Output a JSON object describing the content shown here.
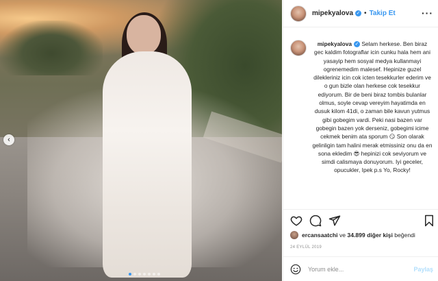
{
  "post": {
    "username": "mipekyalova",
    "separator": "•",
    "follow_label": "Takip Et",
    "more_label": "···",
    "prev_arrow": "‹",
    "carousel": {
      "count": 7,
      "active_index": 0
    }
  },
  "caption": {
    "username": "mipekyalova",
    "text_part1": " Selam herkese. Ben biraz gec kaldim fotograflar icin cunku hala hem ani yasayip hem sosyal medya kullanmayi ogrenemedim malesef. Hepinize guzel dilekleriniz icin cok icten tesekkurler ederim ve o gun bizle olan herkese cok tesekkur ediyorum. Bir de beni biraz tombis bulanlar olmus, soyle cevap vereyim hayatimda en dusuk kilom 41di, o zaman bile kavun yutmus gibi gobegim vardi. Peki nasi bazen var gobegin bazen yok derseniz, gobegimi icime cekmek benim ata sporum ",
    "emoji1": "😏",
    "text_part2": " Son olarak gelinligin tam halini merak etmissiniz onu da en sona ekledim ",
    "emoji2": "😎",
    "text_part3": " hepinizi cok seviyorum ve simdi calismaya donuyorum. Iyi geceler, opucukler, Ipek p.s Yo, Rocky!"
  },
  "likes": {
    "liker": "ercansaatchi",
    "connector": " ve ",
    "others": "34.899 diğer kişi",
    "suffix": " beğendi"
  },
  "date": "24 EYLÜL 2019",
  "comment": {
    "placeholder": "Yorum ekle...",
    "post_label": "Paylaş"
  },
  "colors": {
    "accent": "#3897f0",
    "post_disabled": "#b2dffc",
    "text": "#262626",
    "muted": "#8e8e8e"
  }
}
